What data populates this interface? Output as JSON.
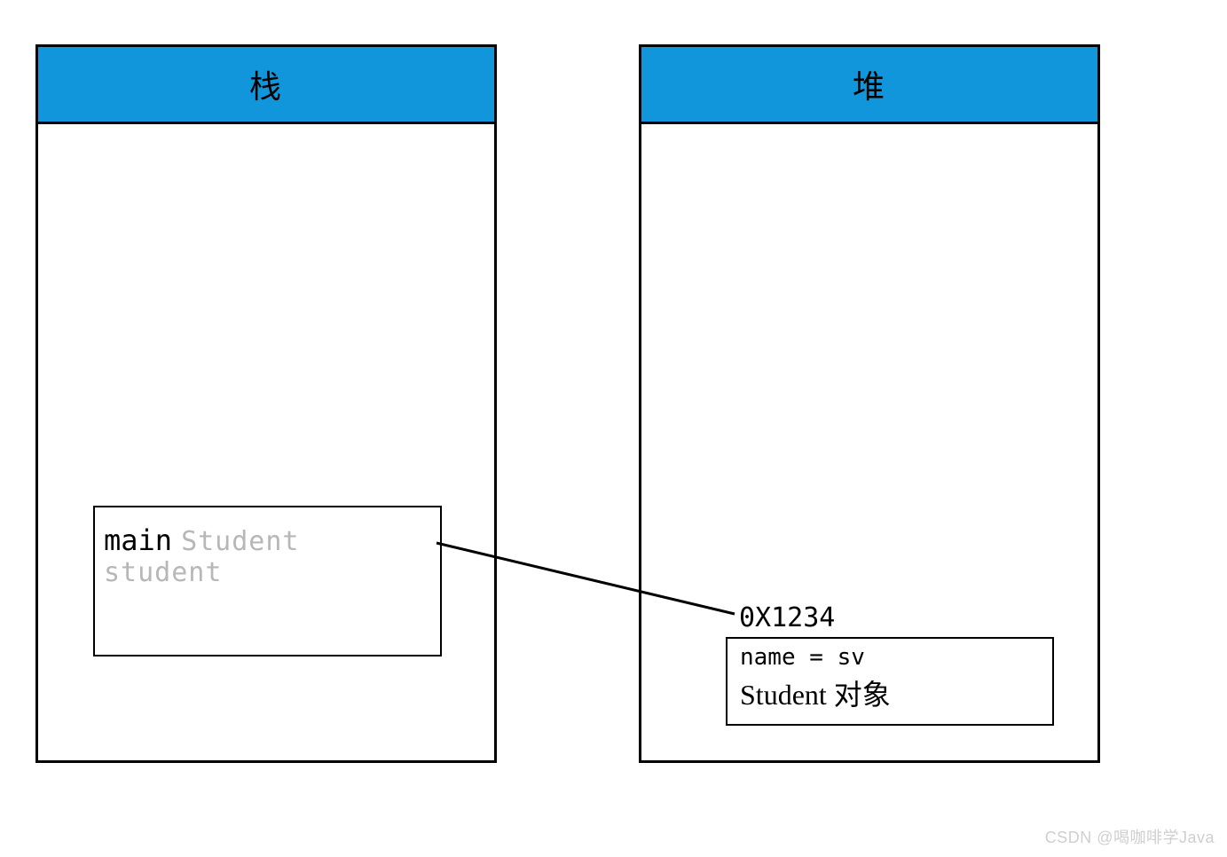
{
  "stack": {
    "title": "栈",
    "main_label": "main",
    "variable_label": "Student student"
  },
  "heap": {
    "title": "堆",
    "address_label": "0X1234",
    "object_field": "name = sv",
    "object_type": "Student 对象"
  },
  "watermark": "CSDN @喝咖啡学Java"
}
